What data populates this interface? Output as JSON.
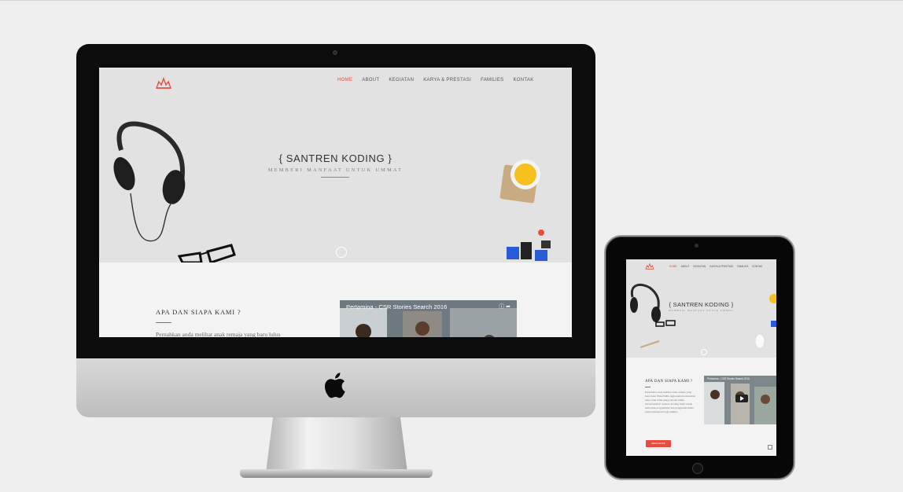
{
  "site": {
    "nav": [
      {
        "label": "HOME",
        "active": true
      },
      {
        "label": "ABOUT",
        "active": false
      },
      {
        "label": "KEGIATAN",
        "active": false
      },
      {
        "label": "KARYA & PRESTASI",
        "active": false
      },
      {
        "label": "FAMILIES",
        "active": false
      },
      {
        "label": "KONTAK",
        "active": false
      }
    ],
    "hero_title": "{ SANTREN KODING }",
    "hero_subtitle": "MEMBERI MANFAAT UNTUK UMMAT",
    "about_title": "APA DAN SIAPA KAMI ?",
    "about_text_preview": "Pernahkan anda melihat anak remaja yang baru lulus",
    "about_text_full": "Pernahkan anda melihat anak remaja yang baru lulus SMA/SMK ingin kuliah terkendala biaya atau tidak punya modal untuk berwirausaha? Santren Koding hadir untuk mencetak programmer dan pengusaha muda yang bermanfaat bagi ummat.",
    "video_title": "Pertamina - CSR Stories Search 2016",
    "video_title_tablet": "Pertamina - CSR Stories Search 2016",
    "more_button": "LEBIH DETAIL"
  },
  "colors": {
    "accent": "#e74c3c",
    "page_bg": "#efefef",
    "hero_bg": "#e2e2e2"
  },
  "icons": [
    "santren-logo-icon",
    "apple-logo-icon",
    "video-info-icon",
    "video-share-icon",
    "scroll-down-icon"
  ]
}
